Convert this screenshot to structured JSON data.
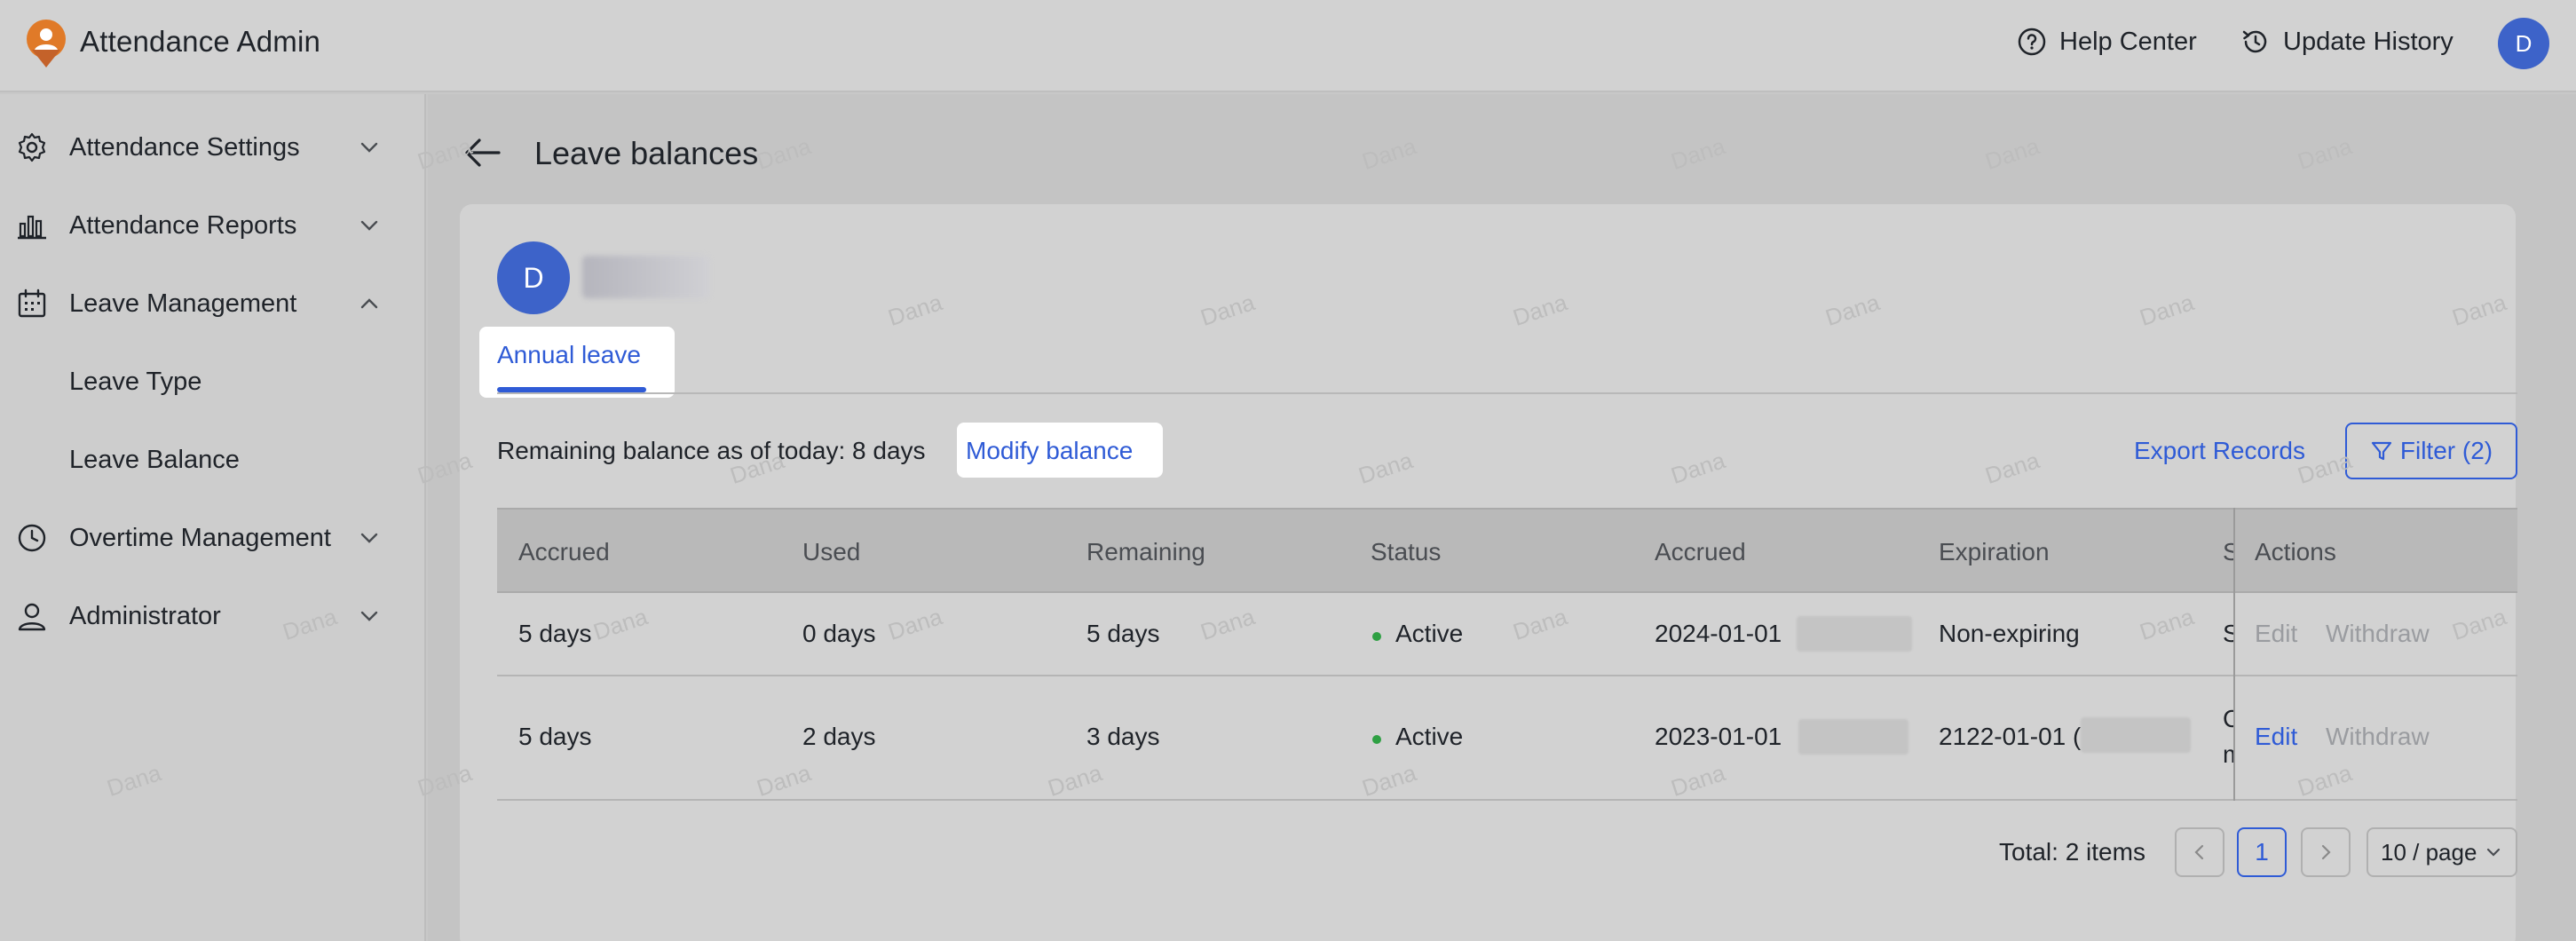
{
  "header": {
    "app_title": "Attendance Admin",
    "help_center": "Help Center",
    "update_history": "Update History",
    "user_initial": "D",
    "brand_color": "#e07a28"
  },
  "sidebar": {
    "items": [
      {
        "label": "Attendance Settings",
        "icon": "gear-icon",
        "expanded": false
      },
      {
        "label": "Attendance Reports",
        "icon": "bar-chart-icon",
        "expanded": false
      },
      {
        "label": "Leave Management",
        "icon": "calendar-icon",
        "expanded": true
      },
      {
        "label": "Leave Type",
        "sub": true
      },
      {
        "label": "Leave Balance",
        "sub": true
      },
      {
        "label": "Overtime Management",
        "icon": "clock-icon",
        "expanded": false
      },
      {
        "label": "Administrator",
        "icon": "person-icon",
        "expanded": false
      }
    ]
  },
  "page": {
    "title": "Leave balances",
    "employee_initial": "D",
    "tab_label": "Annual leave",
    "balance_text": "Remaining balance as of today: 8 days",
    "modify_balance": "Modify balance",
    "export_records": "Export Records",
    "filter_label": "Filter (2)"
  },
  "table": {
    "headers": [
      "Accrued",
      "Used",
      "Remaining",
      "Status",
      "Accrued",
      "Expiration",
      "S",
      "Actions"
    ],
    "rows": [
      {
        "accrued": "5 days",
        "used": "0 days",
        "remaining": "5 days",
        "status": "Active",
        "accrued_date": "2024-01-01",
        "expiration": "Non-expiring",
        "clipped": "S",
        "edit": "Edit",
        "withdraw": "Withdraw",
        "edit_enabled": false
      },
      {
        "accrued": "5 days",
        "used": "2 days",
        "remaining": "3 days",
        "status": "Active",
        "accrued_date": "2023-01-01",
        "expiration": "2122-01-01 (",
        "clipped_top": "C",
        "clipped_bottom": "m",
        "edit": "Edit",
        "withdraw": "Withdraw",
        "edit_enabled": true
      }
    ]
  },
  "pagination": {
    "total": "Total: 2 items",
    "current_page": "1",
    "page_size": "10 / page"
  },
  "watermark": "Dana",
  "colors": {
    "accent": "#2f5bd6",
    "active_status": "#2ea043",
    "avatar": "#3d63c9"
  }
}
